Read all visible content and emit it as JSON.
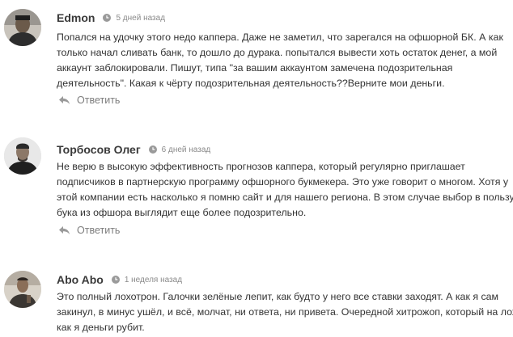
{
  "comments": [
    {
      "author": "Edmon",
      "time": "5 дней назад",
      "lines": [
        "Попался на удочку этого недо каппера. Даже не заметил, что зарегался на офшорной БК. А как",
        "только начал сливать банк, то дошло до дурака. попытался вывести хоть остаток денег, а мой",
        "аккаунт заблокировали. Пишут, типа \"за вашим аккаунтом замечена подозрительная",
        "деятельность\". Какая к чёрту подозрительная деятельность??Верните мои деньги."
      ],
      "reply_label": "Ответить"
    },
    {
      "author": "Торбосов Олег",
      "time": "6 дней назад",
      "lines": [
        "Не верю в высокую эффективность прогнозов каппера, который регулярно приглашает",
        "подписчиков в партнерскую программу офшорного букмекера. Это уже говорит о многом. Хотя у",
        "этой компании есть насколько я помню сайт и для нашего региона. В этом случае выбор в пользу",
        "бука из офшора выглядит еще более подозрительно."
      ],
      "reply_label": "Ответить"
    },
    {
      "author": "Abo Abo",
      "time": "1 неделя назад",
      "lines": [
        "Это полный лохотрон. Галочки зелёные лепит, как будто у него все ставки заходят. А как я сам",
        "закинул, в минус ушёл, и всё, молчат, ни ответа, ни привета. Очередной хитрожоп, который на лохах",
        "как я деньги рубит."
      ],
      "reply_label": ""
    }
  ]
}
